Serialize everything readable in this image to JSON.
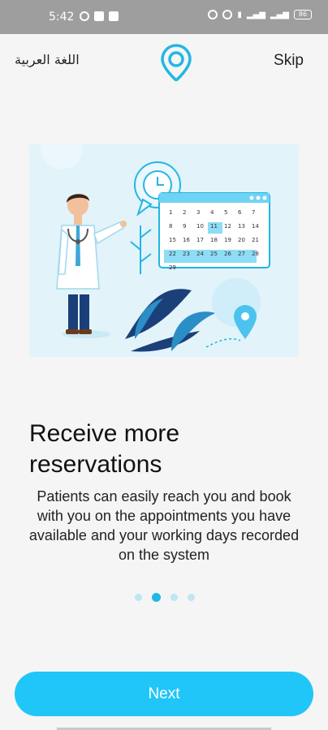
{
  "status_bar": {
    "time": "5:42",
    "battery": "86"
  },
  "header": {
    "language_label": "اللغة العربية",
    "skip_label": "Skip"
  },
  "calendar": {
    "days": [
      "1",
      "2",
      "3",
      "4",
      "5",
      "6",
      "7",
      "8",
      "9",
      "10",
      "11",
      "12",
      "13",
      "14",
      "15",
      "16",
      "17",
      "18",
      "19",
      "20",
      "21",
      "22",
      "23",
      "24",
      "25",
      "26",
      "27",
      "28",
      "29"
    ]
  },
  "onboarding": {
    "title": "Receive more reservations",
    "description": "Patients can easily reach you and book with you on the appointments you have available and your working days recorded on the system",
    "page_count": 4,
    "current_page": 2
  },
  "actions": {
    "next_label": "Next"
  },
  "colors": {
    "accent": "#20c6f7",
    "dot_active": "#22b7e3",
    "dot_inactive": "#bfe6f2",
    "navy": "#1b3f78"
  }
}
